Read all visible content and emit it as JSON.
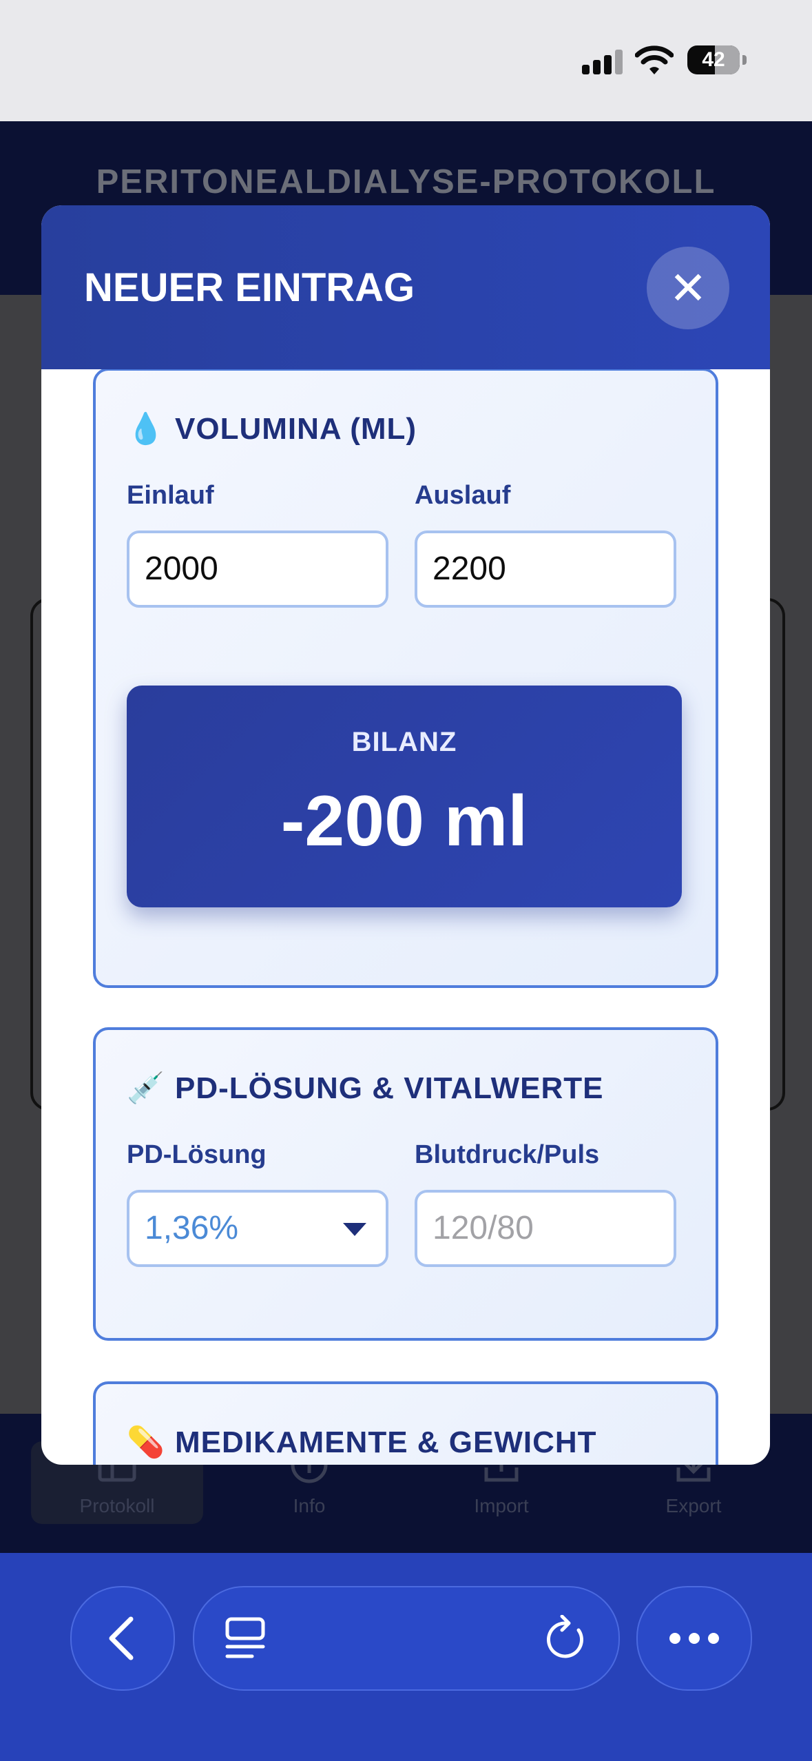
{
  "status_bar": {
    "battery": "42"
  },
  "app": {
    "title": "PERITONEALDIALYSE-PROTOKOLL",
    "tabs": [
      {
        "label": "Protokoll",
        "icon": "grid-icon"
      },
      {
        "label": "Info",
        "icon": "info-icon"
      },
      {
        "label": "Import",
        "icon": "upload-icon"
      },
      {
        "label": "Export",
        "icon": "download-icon"
      }
    ]
  },
  "modal": {
    "title": "NEUER EINTRAG",
    "close_icon": "close-icon",
    "volumina": {
      "emoji": "💧",
      "title": "VOLUMINA (ML)",
      "einlauf_label": "Einlauf",
      "einlauf_value": "2000",
      "auslauf_label": "Auslauf",
      "auslauf_value": "2200",
      "bilanz_label": "BILANZ",
      "bilanz_value": "-200 ml"
    },
    "pd": {
      "emoji": "💉",
      "title": "PD-LÖSUNG & VITALWERTE",
      "loesung_label": "PD-Lösung",
      "loesung_value": "1,36%",
      "blutdruck_label": "Blutdruck/Puls",
      "blutdruck_placeholder": "120/80"
    },
    "medikamente": {
      "emoji": "💊",
      "title": "MEDIKAMENTE & GEWICHT"
    }
  },
  "colors": {
    "accent": "#2c46b6",
    "section_border": "#4f7ddc",
    "header_dark": "#0b1133"
  }
}
